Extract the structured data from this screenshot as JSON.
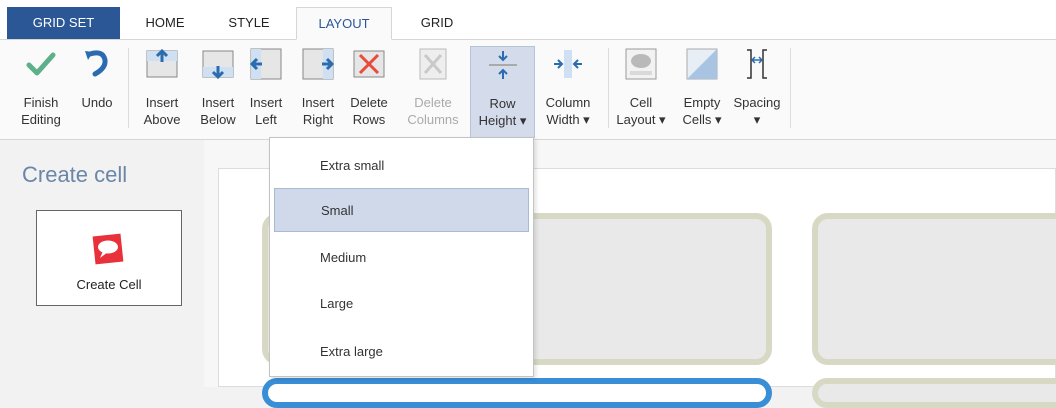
{
  "tabs": {
    "gridset": "GRID SET",
    "home": "HOME",
    "style": "STYLE",
    "layout": "LAYOUT",
    "grid": "GRID"
  },
  "ribbon": {
    "finish": "Finish\nEditing",
    "undo": "Undo",
    "insert_above": "Insert\nAbove",
    "insert_below": "Insert\nBelow",
    "insert_left": "Insert\nLeft",
    "insert_right": "Insert\nRight",
    "delete_rows": "Delete\nRows",
    "delete_columns": "Delete\nColumns",
    "row_height": "Row\nHeight ▾",
    "column_width": "Column\nWidth ▾",
    "cell_layout": "Cell\nLayout ▾",
    "empty_cells": "Empty\nCells ▾",
    "spacing": "Spacing\n▾"
  },
  "left_panel": {
    "title": "Create cell",
    "create_cell_label": "Create Cell"
  },
  "dropdown": {
    "items": [
      "Extra small",
      "Small",
      "Medium",
      "Large",
      "Extra large"
    ],
    "selected": "Small"
  },
  "colors": {
    "brand": "#2b5797",
    "accent_blue": "#3a8ed6",
    "cell_border": "#d8d9c5",
    "selected_bg": "#cfd9e9"
  }
}
